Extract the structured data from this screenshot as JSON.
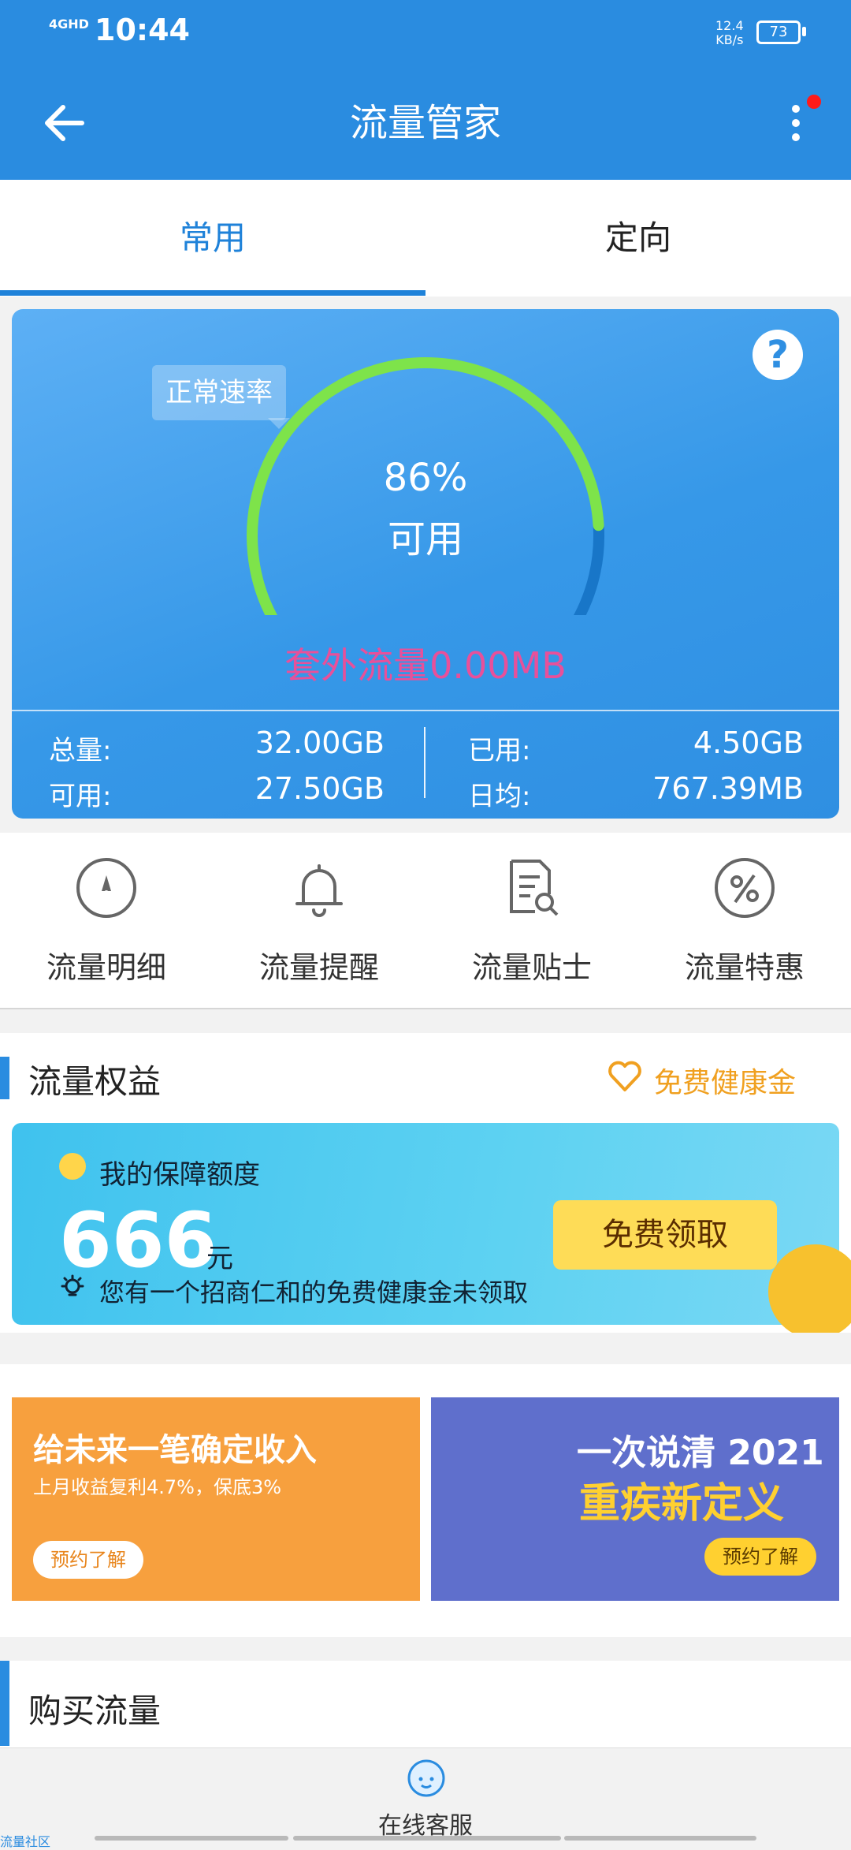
{
  "status": {
    "network": "4GHD",
    "time": "10:44",
    "speed_value": "12.4",
    "speed_unit": "KB/s",
    "battery": "73"
  },
  "header": {
    "title": "流量管家"
  },
  "tabs": [
    {
      "label": "常用",
      "active": true
    },
    {
      "label": "定向",
      "active": false
    }
  ],
  "gauge": {
    "tag": "正常速率",
    "percent_text": "86%",
    "available_label": "可用",
    "percent_value": 0.86,
    "overflow": "套外流量0.00MB"
  },
  "stats": {
    "total_label": "总量:",
    "total": "32.00GB",
    "avail_label": "可用:",
    "avail": "27.50GB",
    "used_label": "已用:",
    "used": "4.50GB",
    "daily_label": "日均:",
    "daily": "767.39MB"
  },
  "menu": [
    {
      "label": "流量明细",
      "icon": "compass-icon"
    },
    {
      "label": "流量提醒",
      "icon": "bell-icon"
    },
    {
      "label": "流量贴士",
      "icon": "document-search-icon"
    },
    {
      "label": "流量特惠",
      "icon": "percent-icon"
    }
  ],
  "benefit": {
    "title": "流量权益",
    "health_link": "免费健康金",
    "card_title": "我的保障额度",
    "amount": "666",
    "unit": "元",
    "tip": "您有一个招商仁和的免费健康金未领取",
    "button": "免费领取"
  },
  "banners": [
    {
      "title": "给未来一笔确定收入",
      "subtitle": "上月收益复利4.7%，保底3%",
      "button": "预约了解"
    },
    {
      "title1": "一次说清 2021",
      "title2": "重疾新定义",
      "button": "预约了解"
    }
  ],
  "buy": {
    "title": "购买流量"
  },
  "bottom": {
    "service": "在线客服",
    "community": "流量社区"
  },
  "colors": {
    "primary": "#2a8ce0",
    "gauge_green": "#7ee34a",
    "gauge_blue": "#1876c8",
    "overflow_pink": "#e8509a",
    "health_orange": "#f0a020",
    "claim_yellow": "#fedc57"
  }
}
